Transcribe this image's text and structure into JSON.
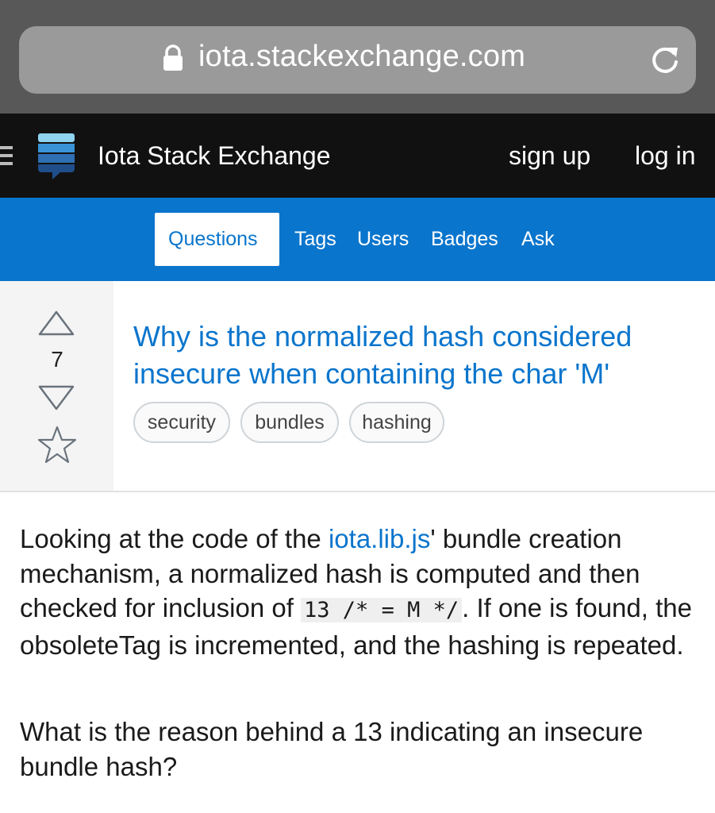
{
  "browser": {
    "url": "iota.stackexchange.com"
  },
  "site": {
    "name": "Iota Stack Exchange",
    "signup": "sign up",
    "login": "log in"
  },
  "nav": {
    "tabs": [
      "Questions",
      "Tags",
      "Users",
      "Badges",
      "Ask"
    ],
    "active": "Questions"
  },
  "question": {
    "votes": "7",
    "title": "Why is the normalized hash considered insecure when containing the char 'M'",
    "tags": [
      "security",
      "bundles",
      "hashing"
    ],
    "body": {
      "p1_a": "Looking at the code of the ",
      "p1_link": "iota.lib.js",
      "p1_b": "' bundle creation mechanism, a normalized hash is computed and then checked for inclusion of ",
      "p1_code": "13 /* = M */",
      "p1_c": ". If one is found, the obsoleteTag is incremented, and the hashing is repeated.",
      "p2": "What is the reason behind a 13 indicating an insecure bundle hash?"
    }
  },
  "colors": {
    "accent": "#0a75cc",
    "topbar": "#111111",
    "chrome": "#585858"
  },
  "icons": [
    "lock-icon",
    "reload-icon",
    "menu-icon",
    "stack-exchange-logo-icon",
    "upvote-icon",
    "downvote-icon",
    "favorite-star-icon"
  ]
}
